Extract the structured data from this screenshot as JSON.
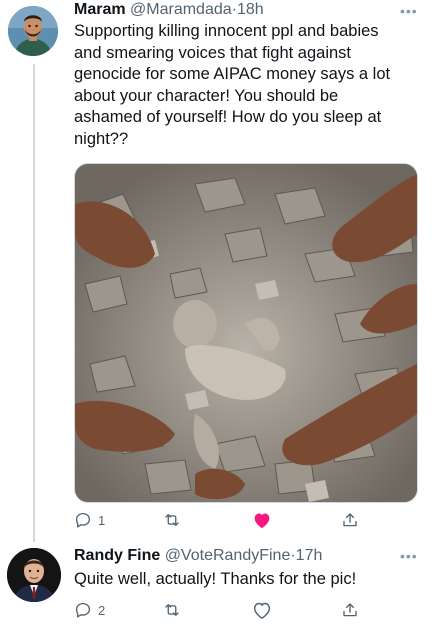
{
  "tweets": [
    {
      "author": {
        "name": "Maram",
        "handle": "@Maramdada"
      },
      "separator": "·",
      "time": "18h",
      "text_lines": [
        "Supporting killing innocent ppl and babies",
        "and smearing voices that fight against",
        "genocide for some AIPAC money says a lot",
        "about your character! You should be",
        "ashamed of yourself! How do you sleep at",
        "night??"
      ],
      "actions": {
        "reply_count": "1",
        "retweet_count": "",
        "like_state": "liked",
        "like_color": "#f91880"
      }
    },
    {
      "author": {
        "name": "Randy Fine",
        "handle": "@VoteRandyFine"
      },
      "separator": "·",
      "time": "17h",
      "text": "Quite well, actually!  Thanks for the pic!",
      "actions": {
        "reply_count": "2",
        "retweet_count": "",
        "like_state": "not-liked"
      }
    }
  ],
  "icons": {
    "reply": "reply-icon",
    "retweet": "retweet-icon",
    "like": "heart-icon",
    "share": "share-icon",
    "more": "more-icon"
  },
  "colors": {
    "text": "#0f1419",
    "secondary": "#536471",
    "liked": "#f91880",
    "thread_line": "#cfd9de"
  }
}
